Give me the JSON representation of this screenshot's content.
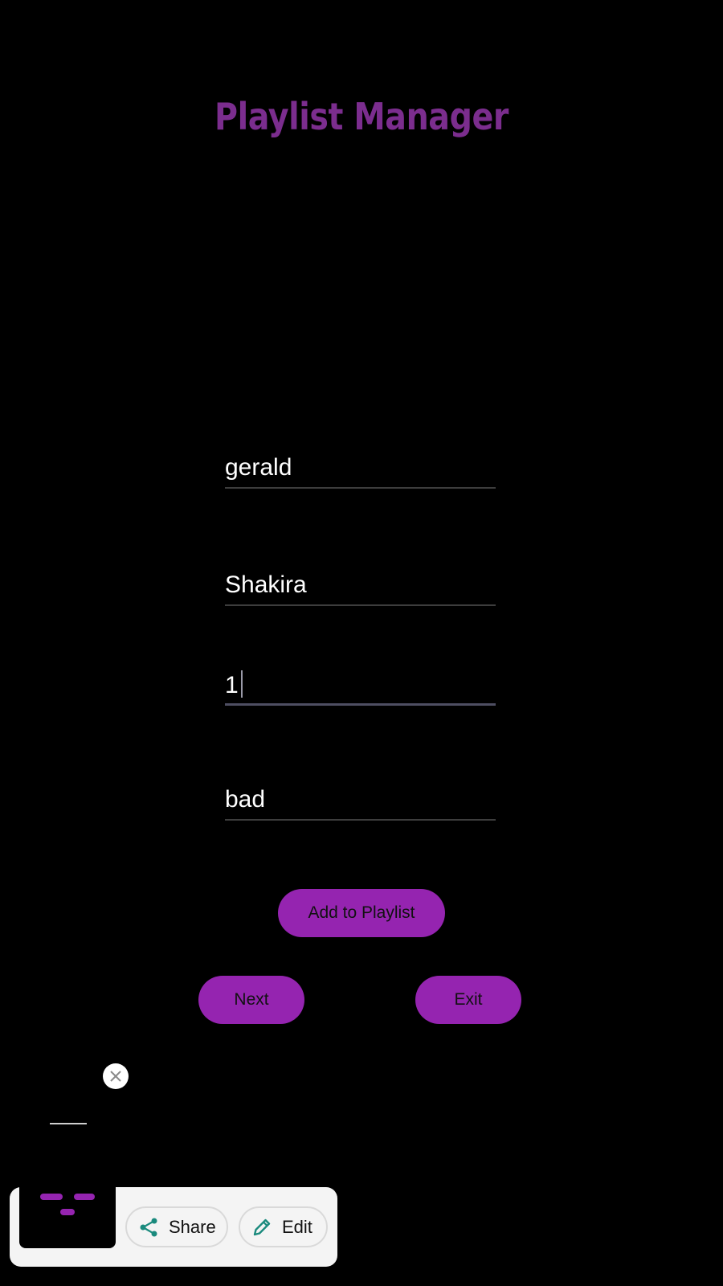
{
  "app": {
    "title": "Playlist Manager",
    "title_color": "#7b2d8e"
  },
  "form": {
    "field1_value": "gerald",
    "field2_value": "Shakira",
    "field3_value": "1",
    "field4_value": "bad"
  },
  "buttons": {
    "add_label": "Add to Playlist",
    "next_label": "Next",
    "exit_label": "Exit",
    "color": "#9524b0"
  },
  "screenshot_popup": {
    "close_icon": "close-icon",
    "share_label": "Share",
    "edit_label": "Edit",
    "share_icon": "share-icon",
    "edit_icon": "pencil-icon",
    "icon_color": "#1a8a7d"
  }
}
